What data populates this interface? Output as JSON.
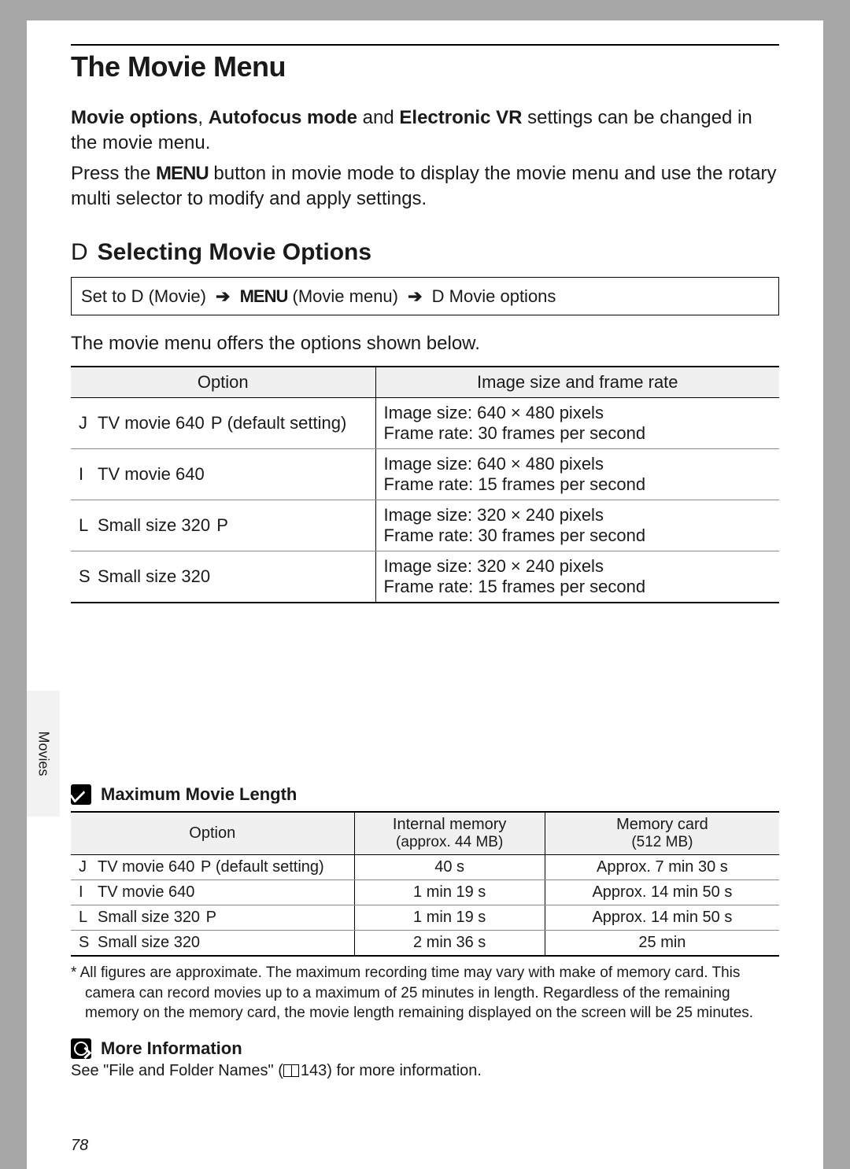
{
  "title": "The Movie Menu",
  "intro": {
    "bold1": "Movie options",
    "sep": ", ",
    "bold2": "Autofocus mode",
    "mid": " and ",
    "bold3": "Electronic VR",
    "tail": " settings can be changed in the movie menu."
  },
  "press1": "Press the ",
  "menu_word": "MENU",
  "press2": " button in movie mode to display the movie menu and use the rotary multi selector to modify and apply settings.",
  "section": {
    "mark": "D",
    "title": "Selecting Movie Options"
  },
  "path": {
    "p1a": "Set to ",
    "p1b": "D",
    "p1c": "  (Movie) ",
    "p2a": "MENU",
    "p2b": " (Movie menu) ",
    "p3a": "D",
    "p3b": "  Movie options"
  },
  "lead": "The movie menu offers the options shown below.",
  "opts_head": {
    "c1": "Option",
    "c2": "Image size and frame rate"
  },
  "opts": [
    {
      "icon": "J",
      "name": "TV movie 640",
      "suf": "P",
      "extra": "   (default setting)",
      "l1": "Image size: 640 × 480 pixels",
      "l2": "Frame rate: 30 frames per second"
    },
    {
      "icon": "I",
      "name": "TV movie 640",
      "suf": "",
      "extra": "",
      "l1": "Image size: 640 × 480 pixels",
      "l2": "Frame rate: 15 frames per second"
    },
    {
      "icon": "L",
      "name": "Small size 320",
      "suf": "P",
      "extra": "",
      "l1": "Image size: 320 × 240 pixels",
      "l2": "Frame rate: 30 frames per second"
    },
    {
      "icon": "S",
      "name": "Small size 320",
      "suf": "",
      "extra": "",
      "l1": "Image size: 320 × 240 pixels",
      "l2": "Frame rate: 15 frames per second"
    }
  ],
  "note_title": "Maximum Movie Length",
  "len_head": {
    "c1": "Option",
    "c2a": "Internal memory",
    "c2b": "(approx. 44 MB)",
    "c3a": "Memory card",
    "c3b": "(512 MB)"
  },
  "len": [
    {
      "icon": "J",
      "name": "TV movie 640",
      "suf": "P",
      "extra": "   (default setting)",
      "a": "40 s",
      "b": "Approx. 7 min 30 s"
    },
    {
      "icon": "I",
      "name": "TV movie 640",
      "suf": "",
      "extra": "",
      "a": "1 min 19 s",
      "b": "Approx. 14 min 50 s"
    },
    {
      "icon": "L",
      "name": "Small size 320",
      "suf": "P",
      "extra": "",
      "a": "1 min 19 s",
      "b": "Approx. 14 min 50 s"
    },
    {
      "icon": "S",
      "name": "Small size 320",
      "suf": "",
      "extra": "",
      "a": "2 min 36 s",
      "b": "25 min"
    }
  ],
  "footnote": "*  All figures are approximate. The maximum recording time may vary with make of memory card. This camera can record movies up to a maximum of 25 minutes in length. Regardless of the remaining memory on the memory card, the movie length remaining displayed on the screen will be 25 minutes.",
  "more_title": "More Information",
  "more_text1": "See \"File and Folder Names\" (",
  "more_text2": "143) for more information.",
  "side_tab": "Movies",
  "page_num": "78"
}
